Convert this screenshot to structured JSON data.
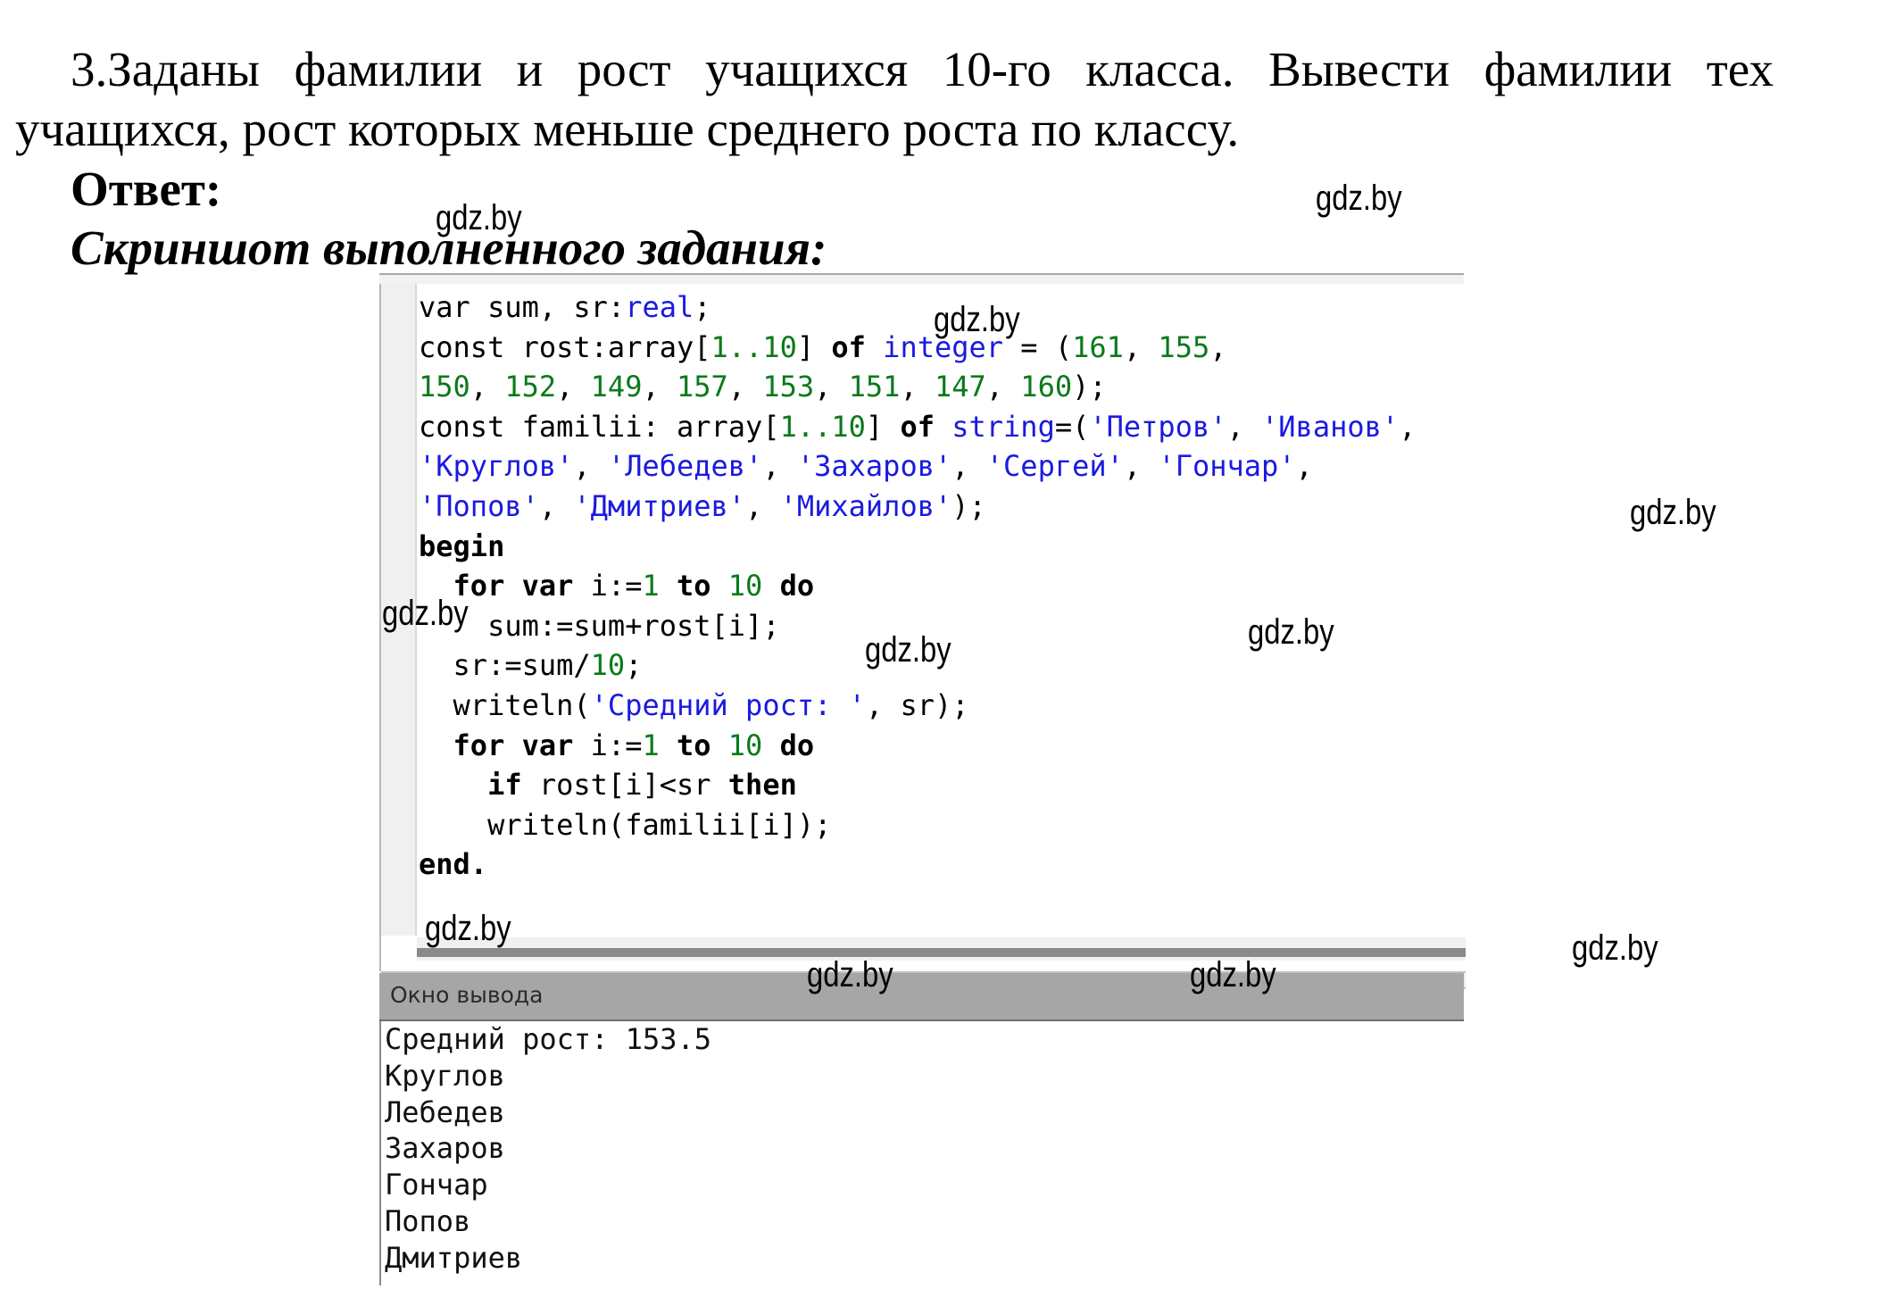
{
  "task": {
    "line1": "3.Заданы фамилии и рост учащихся 10-го класса. Вывести фамилии тех",
    "line2": "учащихся, рост которых меньше среднего роста по классу."
  },
  "answer_label": "Ответ:",
  "screenshot_label": "Скриншот выполненного задания:",
  "editor": {
    "lines": [
      [
        {
          "t": "var sum, sr:",
          "c": ""
        },
        {
          "t": "real",
          "c": "ty"
        },
        {
          "t": ";",
          "c": ""
        }
      ],
      [
        {
          "t": "const rost:array[",
          "c": ""
        },
        {
          "t": "1..10",
          "c": "num"
        },
        {
          "t": "] ",
          "c": ""
        },
        {
          "t": "of",
          "c": "kw"
        },
        {
          "t": " ",
          "c": ""
        },
        {
          "t": "integer",
          "c": "ty"
        },
        {
          "t": " = (",
          "c": ""
        },
        {
          "t": "161",
          "c": "num"
        },
        {
          "t": ", ",
          "c": ""
        },
        {
          "t": "155",
          "c": "num"
        },
        {
          "t": ",",
          "c": ""
        }
      ],
      [
        {
          "t": "150",
          "c": "num"
        },
        {
          "t": ", ",
          "c": ""
        },
        {
          "t": "152",
          "c": "num"
        },
        {
          "t": ", ",
          "c": ""
        },
        {
          "t": "149",
          "c": "num"
        },
        {
          "t": ", ",
          "c": ""
        },
        {
          "t": "157",
          "c": "num"
        },
        {
          "t": ", ",
          "c": ""
        },
        {
          "t": "153",
          "c": "num"
        },
        {
          "t": ", ",
          "c": ""
        },
        {
          "t": "151",
          "c": "num"
        },
        {
          "t": ", ",
          "c": ""
        },
        {
          "t": "147",
          "c": "num"
        },
        {
          "t": ", ",
          "c": ""
        },
        {
          "t": "160",
          "c": "num"
        },
        {
          "t": ");",
          "c": ""
        }
      ],
      [
        {
          "t": "const familii: array[",
          "c": ""
        },
        {
          "t": "1..10",
          "c": "num"
        },
        {
          "t": "] ",
          "c": ""
        },
        {
          "t": "of",
          "c": "kw"
        },
        {
          "t": " ",
          "c": ""
        },
        {
          "t": "string",
          "c": "ty"
        },
        {
          "t": "=(",
          "c": ""
        },
        {
          "t": "'Петров'",
          "c": "str"
        },
        {
          "t": ", ",
          "c": ""
        },
        {
          "t": "'Иванов'",
          "c": "str"
        },
        {
          "t": ",",
          "c": ""
        }
      ],
      [
        {
          "t": "'Круглов'",
          "c": "str"
        },
        {
          "t": ", ",
          "c": ""
        },
        {
          "t": "'Лебедев'",
          "c": "str"
        },
        {
          "t": ", ",
          "c": ""
        },
        {
          "t": "'Захаров'",
          "c": "str"
        },
        {
          "t": ", ",
          "c": ""
        },
        {
          "t": "'Сергей'",
          "c": "str"
        },
        {
          "t": ", ",
          "c": ""
        },
        {
          "t": "'Гончар'",
          "c": "str"
        },
        {
          "t": ",",
          "c": ""
        }
      ],
      [
        {
          "t": "'Попов'",
          "c": "str"
        },
        {
          "t": ", ",
          "c": ""
        },
        {
          "t": "'Дмитриев'",
          "c": "str"
        },
        {
          "t": ", ",
          "c": ""
        },
        {
          "t": "'Михайлов'",
          "c": "str"
        },
        {
          "t": ");",
          "c": ""
        }
      ],
      [
        {
          "t": "begin",
          "c": "kw"
        }
      ],
      [
        {
          "t": "  ",
          "c": ""
        },
        {
          "t": "for var",
          "c": "kw"
        },
        {
          "t": " i:=",
          "c": ""
        },
        {
          "t": "1",
          "c": "num"
        },
        {
          "t": " ",
          "c": ""
        },
        {
          "t": "to",
          "c": "kw"
        },
        {
          "t": " ",
          "c": ""
        },
        {
          "t": "10",
          "c": "num"
        },
        {
          "t": " ",
          "c": ""
        },
        {
          "t": "do",
          "c": "kw"
        }
      ],
      [
        {
          "t": "    sum:=sum+rost[i];",
          "c": ""
        }
      ],
      [
        {
          "t": "  sr:=sum/",
          "c": ""
        },
        {
          "t": "10",
          "c": "num"
        },
        {
          "t": ";",
          "c": ""
        }
      ],
      [
        {
          "t": "  writeln(",
          "c": ""
        },
        {
          "t": "'Средний рост: '",
          "c": "str"
        },
        {
          "t": ", sr);",
          "c": ""
        }
      ],
      [
        {
          "t": "  ",
          "c": ""
        },
        {
          "t": "for var",
          "c": "kw"
        },
        {
          "t": " i:=",
          "c": ""
        },
        {
          "t": "1",
          "c": "num"
        },
        {
          "t": " ",
          "c": ""
        },
        {
          "t": "to",
          "c": "kw"
        },
        {
          "t": " ",
          "c": ""
        },
        {
          "t": "10",
          "c": "num"
        },
        {
          "t": " ",
          "c": ""
        },
        {
          "t": "do",
          "c": "kw"
        }
      ],
      [
        {
          "t": "    ",
          "c": ""
        },
        {
          "t": "if",
          "c": "kw"
        },
        {
          "t": " rost[i]<sr ",
          "c": ""
        },
        {
          "t": "then",
          "c": "kw"
        }
      ],
      [
        {
          "t": "    writeln(familii[i]);",
          "c": ""
        }
      ],
      [
        {
          "t": "end.",
          "c": "kw"
        }
      ]
    ]
  },
  "output": {
    "title": "Окно вывода",
    "lines": [
      "Средний рост: 153.5",
      "Круглов",
      "Лебедев",
      "Захаров",
      "Гончар",
      "Попов",
      "Дмитриев"
    ]
  },
  "colors": {
    "keyword": "#000000",
    "type": "#1a1ae0",
    "number": "#0a7a1a",
    "string": "#1a1ae0",
    "output_header": "#a6a6a6"
  },
  "watermarks": [
    "gdz.by",
    "gdz.by",
    "gdz.by",
    "gdz.by",
    "gdz.by",
    "gdz.by",
    "gdz.by",
    "gdz.by",
    "gdz.by",
    "gdz.by",
    "gdz.by"
  ]
}
